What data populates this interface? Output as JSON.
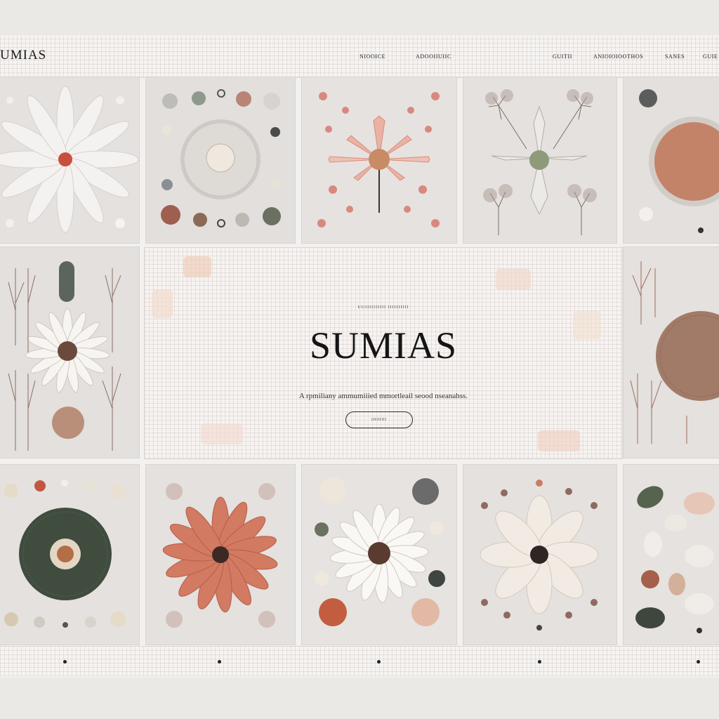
{
  "header": {
    "brand": "UMIAS",
    "nav": [
      "NIOOICE",
      "ADOOIIUIIC",
      "GUITII",
      "ANIOIOIOOTHOS",
      "SANES",
      "GUIE"
    ]
  },
  "hero": {
    "kicker": "UUIIIIIIIIII IIIIIIIIII",
    "title": "SUMIAS",
    "tagline": "A rpmiliany ammumiiied mmortleail seood nseanahss.",
    "button": "IIIIIIIII"
  },
  "pager": {
    "dots": 5
  },
  "colors": {
    "background": "#ebe9e6",
    "accent": "#c76a4d",
    "ink": "#151515"
  }
}
